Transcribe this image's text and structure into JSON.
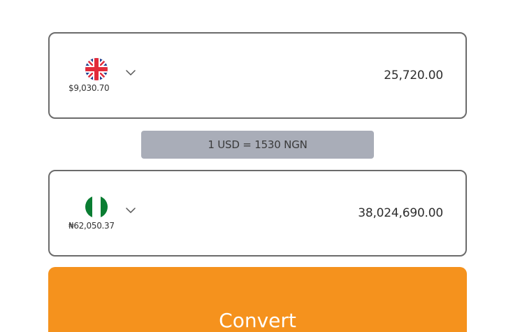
{
  "from": {
    "currency_icon": "uk-flag-icon",
    "balance": "$9,030.70",
    "amount": "25,720.00"
  },
  "rate": {
    "text": "1 USD = 1530 NGN"
  },
  "to": {
    "currency_icon": "nigeria-flag-icon",
    "balance": "₦62,050.37",
    "amount": "38,024,690.00"
  },
  "actions": {
    "convert_label": "Convert"
  },
  "colors": {
    "accent": "#f5921d",
    "rate_pill": "#a9adb8",
    "card_border": "#6b6b6b",
    "nigeria_green": "#0a7d32"
  }
}
